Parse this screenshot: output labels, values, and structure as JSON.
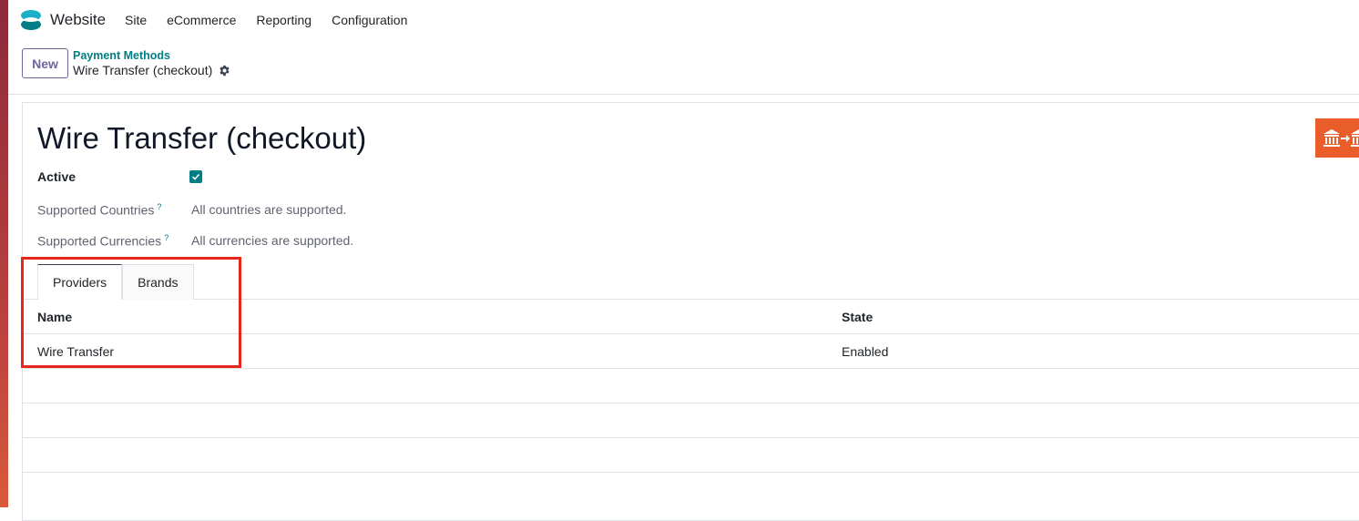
{
  "app": {
    "name": "Website",
    "brand_color": "#017e84",
    "accent_color": "#71639e"
  },
  "menu": [
    {
      "label": "Site"
    },
    {
      "label": "eCommerce"
    },
    {
      "label": "Reporting"
    },
    {
      "label": "Configuration"
    }
  ],
  "controlbar": {
    "new_label": "New",
    "breadcrumb_parent": "Payment Methods",
    "breadcrumb_current": "Wire Transfer (checkout)"
  },
  "record": {
    "title": "Wire Transfer (checkout)",
    "active_label": "Active",
    "active_checked": true,
    "fields": [
      {
        "label": "Supported Countries",
        "help": "?",
        "value": "All countries are supported."
      },
      {
        "label": "Supported Currencies",
        "help": "?",
        "value": "All currencies are supported."
      }
    ],
    "provider_icon": "bank-transfer-icon",
    "provider_icon_color": "#e85d2a"
  },
  "tabs": [
    {
      "label": "Providers",
      "active": true
    },
    {
      "label": "Brands",
      "active": false
    }
  ],
  "table": {
    "columns": [
      "Name",
      "State"
    ],
    "rows": [
      {
        "name": "Wire Transfer",
        "state": "Enabled"
      }
    ]
  },
  "annotation": {
    "highlight_color": "#e8261c"
  }
}
